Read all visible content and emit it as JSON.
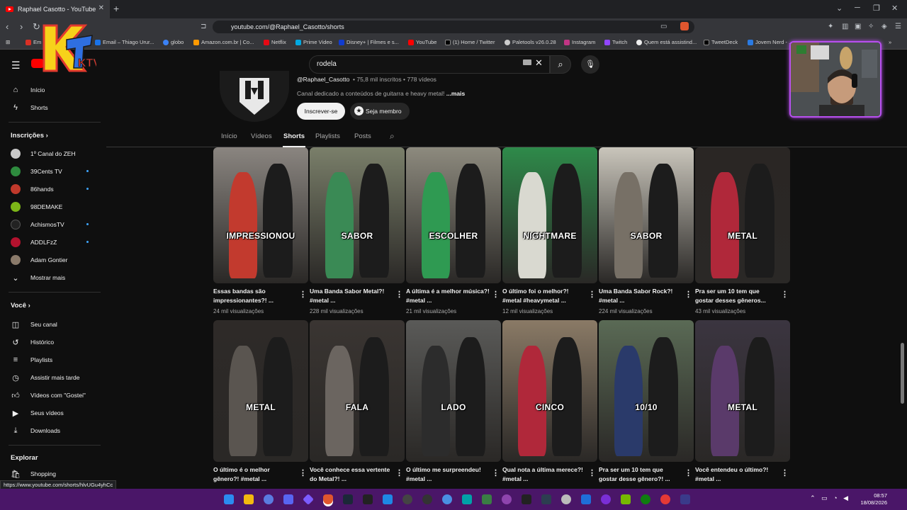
{
  "browser": {
    "tab_title": "Raphael Casotto - YouTube",
    "url": "youtube.com/@Raphael_Casotto/shorts",
    "status_url": "https://www.youtube.com/shorts/hlvUGu4yhCc",
    "bookmarks": [
      "Em",
      "Email – Thiago Urur...",
      "globo",
      "Amazon.com.br | Co...",
      "Netflix",
      "Prime Video",
      "Disney+ | Filmes e s...",
      "YouTube",
      "(1) Home / Twitter",
      "Paletools v26.0.28",
      "Instagram",
      "Twitch",
      "Quem está assistind...",
      "TweetDeck",
      "Jovem Nerd - ..."
    ]
  },
  "search": {
    "query": "rodela"
  },
  "sidebar": {
    "main": [
      {
        "label": "Início",
        "icon": "home-icon"
      },
      {
        "label": "Shorts",
        "icon": "shorts-icon"
      }
    ],
    "subscriptions_heading": "Inscrições",
    "subscriptions": [
      {
        "label": "1º Canal do ZEH",
        "color": "#c9c9c9",
        "dot": false
      },
      {
        "label": "39Cents TV",
        "color": "#2e8b3e",
        "dot": true
      },
      {
        "label": "86hands",
        "color": "#c0392b",
        "dot": true
      },
      {
        "label": "98DEMAKE",
        "color": "#7cb518",
        "dot": false
      },
      {
        "label": "AchismosTV",
        "color": "#222222",
        "dot": true
      },
      {
        "label": "ADDLFzZ",
        "color": "#b3122e",
        "dot": true
      },
      {
        "label": "Adam Gontier",
        "color": "#8a7a6a",
        "dot": false
      }
    ],
    "show_more": "Mostrar mais",
    "you_heading": "Você",
    "you_items": [
      {
        "label": "Seu canal",
        "icon": "person-icon"
      },
      {
        "label": "Histórico",
        "icon": "history-icon"
      },
      {
        "label": "Playlists",
        "icon": "playlist-icon"
      },
      {
        "label": "Assistir mais tarde",
        "icon": "clock-icon"
      },
      {
        "label": "Vídeos com \"Gostei\"",
        "icon": "thumbs-up-icon"
      },
      {
        "label": "Seus vídeos",
        "icon": "video-icon"
      },
      {
        "label": "Downloads",
        "icon": "download-icon"
      }
    ],
    "explore_heading": "Explorar",
    "explore_items": [
      {
        "label": "Shopping",
        "icon": "bag-icon"
      }
    ]
  },
  "channel": {
    "handle": "@Raphael_Casotto",
    "meta": "• 75,8 mil inscritos • 778 vídeos",
    "description": "Canal dedicado a conteúdos de guitarra e heavy metal!",
    "more": "...mais",
    "subscribe": "Inscrever-se",
    "join": "Seja membro",
    "tabs": [
      "Início",
      "Vídeos",
      "Shorts",
      "Playlists",
      "Posts"
    ],
    "active_tab": "Shorts"
  },
  "shorts": [
    {
      "word": "IMPRESSIONOU",
      "title": "Essas bandas são impressionantes?! ...",
      "views": "24 mil visualizações",
      "bg": "#8a8580",
      "accent": "#c23a2e"
    },
    {
      "word": "SABOR",
      "title": "Uma Banda Sabor Metal?! #metal ...",
      "views": "228 mil visualizações",
      "bg": "#7a7f6a",
      "accent": "#3a8a55"
    },
    {
      "word": "ESCOLHER",
      "title": "A última é a melhor música?! #metal ...",
      "views": "21 mil visualizações",
      "bg": "#8d8a7e",
      "accent": "#2f9a52"
    },
    {
      "word": "NIGHTMARE",
      "title": "O último foi o melhor?! #metal #heavymetal ...",
      "views": "12 mil visualizações",
      "bg": "#2e8a4a",
      "accent": "#d9d9d0"
    },
    {
      "word": "SABOR",
      "title": "Uma Banda Sabor Rock?! #metal ...",
      "views": "224 mil visualizações",
      "bg": "#c9c5bb",
      "accent": "#777066"
    },
    {
      "word": "METAL",
      "title": "Pra ser um 10 tem que gostar desses gêneros...",
      "views": "43 mil visualizações",
      "bg": "#2a2624",
      "accent": "#b0283a"
    },
    {
      "word": "METAL",
      "title": "O último é o melhor gênero?! #metal ...",
      "views": "",
      "bg": "#2e2a28",
      "accent": "#5a5550"
    },
    {
      "word": "FALA",
      "title": "Você conhece essa vertente do Metal?! ...",
      "views": "",
      "bg": "#3a3532",
      "accent": "#6b6560"
    },
    {
      "word": "LADO",
      "title": "O último me surpreendeu! #metal ...",
      "views": "",
      "bg": "#5a5a58",
      "accent": "#2c2c2c"
    },
    {
      "word": "CINCO",
      "title": "Qual nota a última merece?! #metal ...",
      "views": "",
      "bg": "#8a7a66",
      "accent": "#b0283a"
    },
    {
      "word": "10/10",
      "title": "Pra ser um 10 tem que gostar desse gênero?! ...",
      "views": "",
      "bg": "#5a6a55",
      "accent": "#2a3a6a"
    },
    {
      "word": "METAL",
      "title": "Você entendeu o último?! #metal ...",
      "views": "",
      "bg": "#3b3540",
      "accent": "#5a3a6a"
    }
  ],
  "taskbar": {
    "time": "08:57",
    "date": "18/08/2026"
  },
  "overlay": {
    "logo_text": "KTV"
  }
}
